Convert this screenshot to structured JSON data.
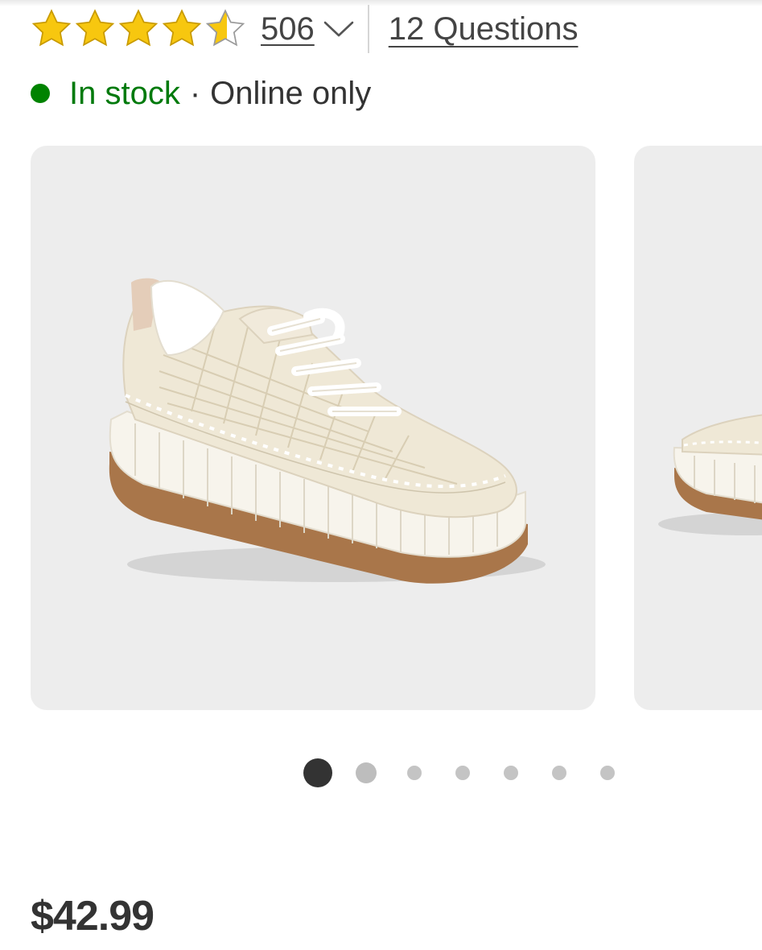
{
  "rating": {
    "value": 4.5,
    "max": 5,
    "review_count": "506",
    "questions_label": "12 Questions",
    "star_color": "#f7c70f"
  },
  "stock": {
    "status": "In stock",
    "separator": "·",
    "channel": "Online only",
    "status_color": "#008300"
  },
  "carousel": {
    "slide_count": 7,
    "active_index": 0,
    "current_image": "platform-woven-sneaker-image",
    "next_image": "platform-woven-sneaker-image-alt"
  },
  "price": "$42.99"
}
